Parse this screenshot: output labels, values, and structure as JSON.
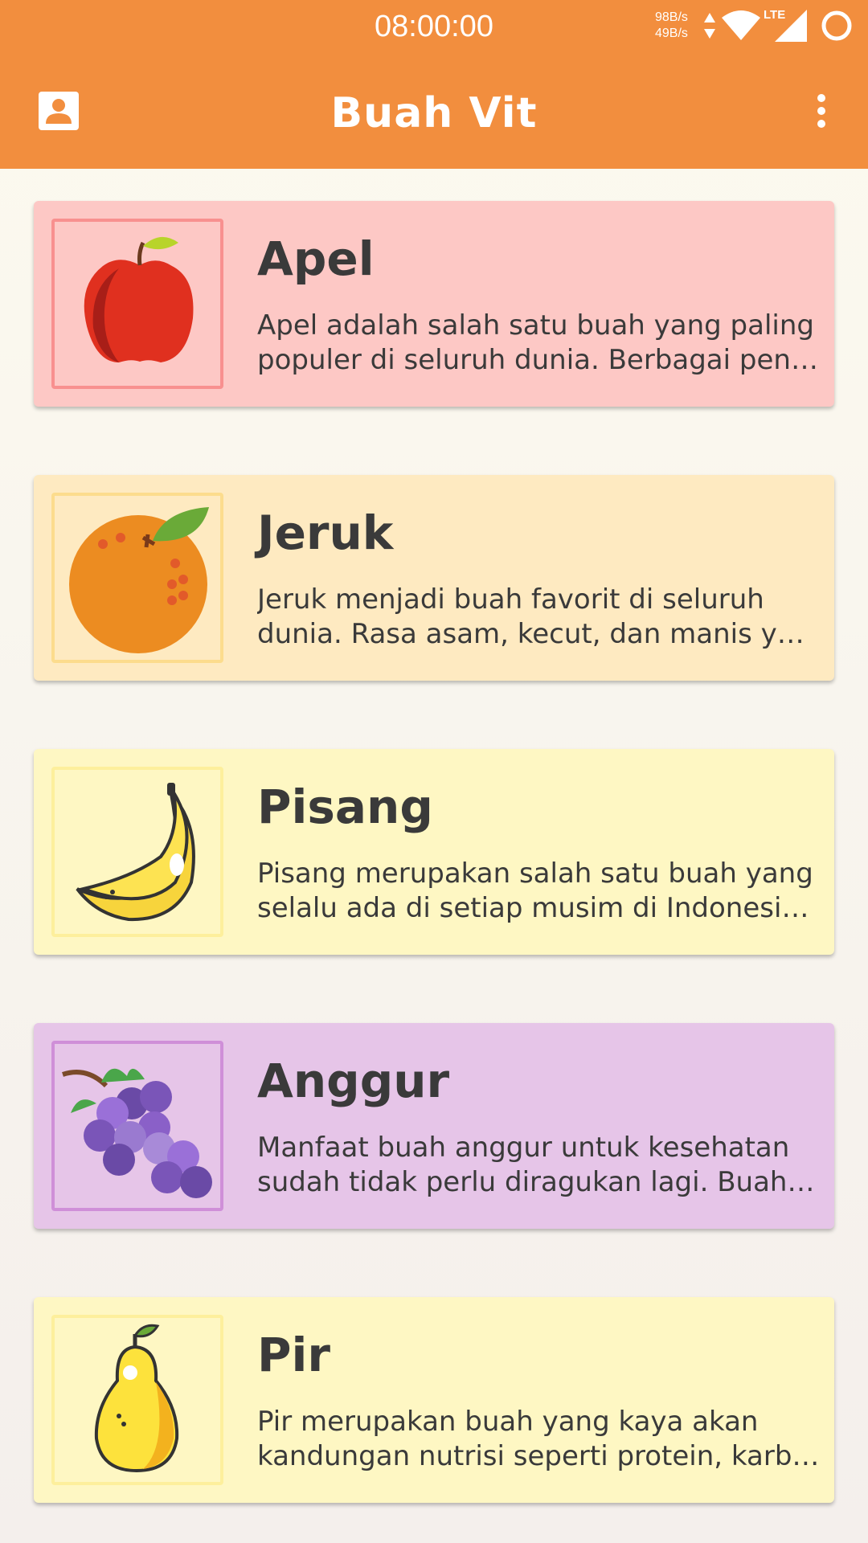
{
  "status_bar": {
    "time": "08:00:00",
    "speed_up": "98B/s",
    "speed_down": "49B/s",
    "network": "LTE",
    "icons": [
      "data-arrows-icon",
      "wifi-icon",
      "signal-icon",
      "ring-icon"
    ]
  },
  "app_bar": {
    "title": "Buah Vit",
    "left_icon": "profile-icon",
    "right_icon": "more-vert-icon"
  },
  "colors": {
    "primary": "#f28e3e",
    "text": "#3a3a3a"
  },
  "fruits": [
    {
      "name": "Apel",
      "line1": "Apel adalah salah satu buah yang paling",
      "line2": "populer di seluruh dunia. Berbagai peneli…",
      "icon": "apple-icon",
      "bg": "#fdc8c5",
      "border": "#f8908f"
    },
    {
      "name": "Jeruk",
      "line1": "Jeruk menjadi buah favorit di seluruh",
      "line2": "dunia. Rasa asam, kecut, dan manis yang…",
      "icon": "orange-icon",
      "bg": "#feeac1",
      "border": "#fcdc8d"
    },
    {
      "name": "Pisang",
      "line1": "Pisang merupakan salah satu buah yang",
      "line2": "selalu ada di setiap musim di Indonesia. …",
      "icon": "banana-icon",
      "bg": "#fef7c3",
      "border": "#fdef9c"
    },
    {
      "name": "Anggur",
      "line1": "Manfaat buah anggur untuk kesehatan",
      "line2": "sudah tidak perlu diragukan lagi. Buah ya…",
      "icon": "grapes-icon",
      "bg": "#e6c5e8",
      "border": "#cf8fd8"
    },
    {
      "name": "Pir",
      "line1": "Pir merupakan buah yang kaya akan",
      "line2": "kandungan nutrisi seperti protein, karboh…",
      "icon": "pear-icon",
      "bg": "#fef7c3",
      "border": "#fdef9c"
    }
  ]
}
